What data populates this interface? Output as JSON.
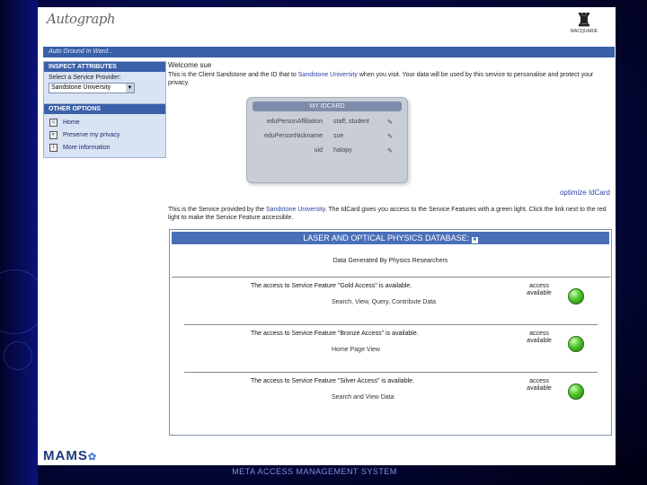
{
  "app": {
    "logo": "Autograph",
    "tagline": "Auto Ground In Ward..."
  },
  "institution": {
    "name": "MACQUARIE",
    "sub": "UNIVERSITY · SYDNEY"
  },
  "sidebar": {
    "inspect": {
      "title": "INSPECT ATTRIBUTES",
      "label": "Select a Service Provider:",
      "selected": "Sandstone University"
    },
    "other": {
      "title": "OTHER OPTIONS",
      "items": [
        {
          "label": "Home",
          "icon": "home-icon"
        },
        {
          "label": "Preserve my privacy",
          "icon": "privacy-icon"
        },
        {
          "label": "More information",
          "icon": "info-icon"
        }
      ]
    }
  },
  "main": {
    "welcome": "Welcome sue",
    "intro_pre": "This is the Client Sandstone and the ID that to",
    "intro_link": "Sandstone University",
    "intro_post": "when you visit. Your data will be used by this service to personalise and protect your privacy.",
    "idcard": {
      "title": "MY IDCARD",
      "rows": [
        {
          "key": "eduPersonAffiliation",
          "value": "staff, student"
        },
        {
          "key": "eduPersonNickname",
          "value": "sue"
        },
        {
          "key": "uid",
          "value": "halopy"
        }
      ]
    },
    "optimize": "optimize IdCard",
    "service_pre": "This is the Service provided by the",
    "service_link": "Sandstone University",
    "service_post": "The IdCard gives you access to the Service Features with a green light. Click the link next to the red light to make the Service Feature accessible.",
    "db": {
      "title": "LASER AND OPTICAL PHYSICS DATABASE",
      "subtitle": "Data Generated By Physics Researchers",
      "features": [
        {
          "text": "The access to Service Feature \"Gold Access\" is available.",
          "desc": "Search, View, Query, Contribute Data",
          "status": "access available"
        },
        {
          "text": "The access to Service Feature \"Bronze Access\" is available.",
          "desc": "Home Page View",
          "status": "access available"
        },
        {
          "text": "The access to Service Feature \"Silver Access\" is available.",
          "desc": "Search and View Data",
          "status": "access available"
        }
      ]
    }
  },
  "brand": {
    "mams": "MAMS"
  },
  "footer": "META ACCESS MANAGEMENT SYSTEM"
}
